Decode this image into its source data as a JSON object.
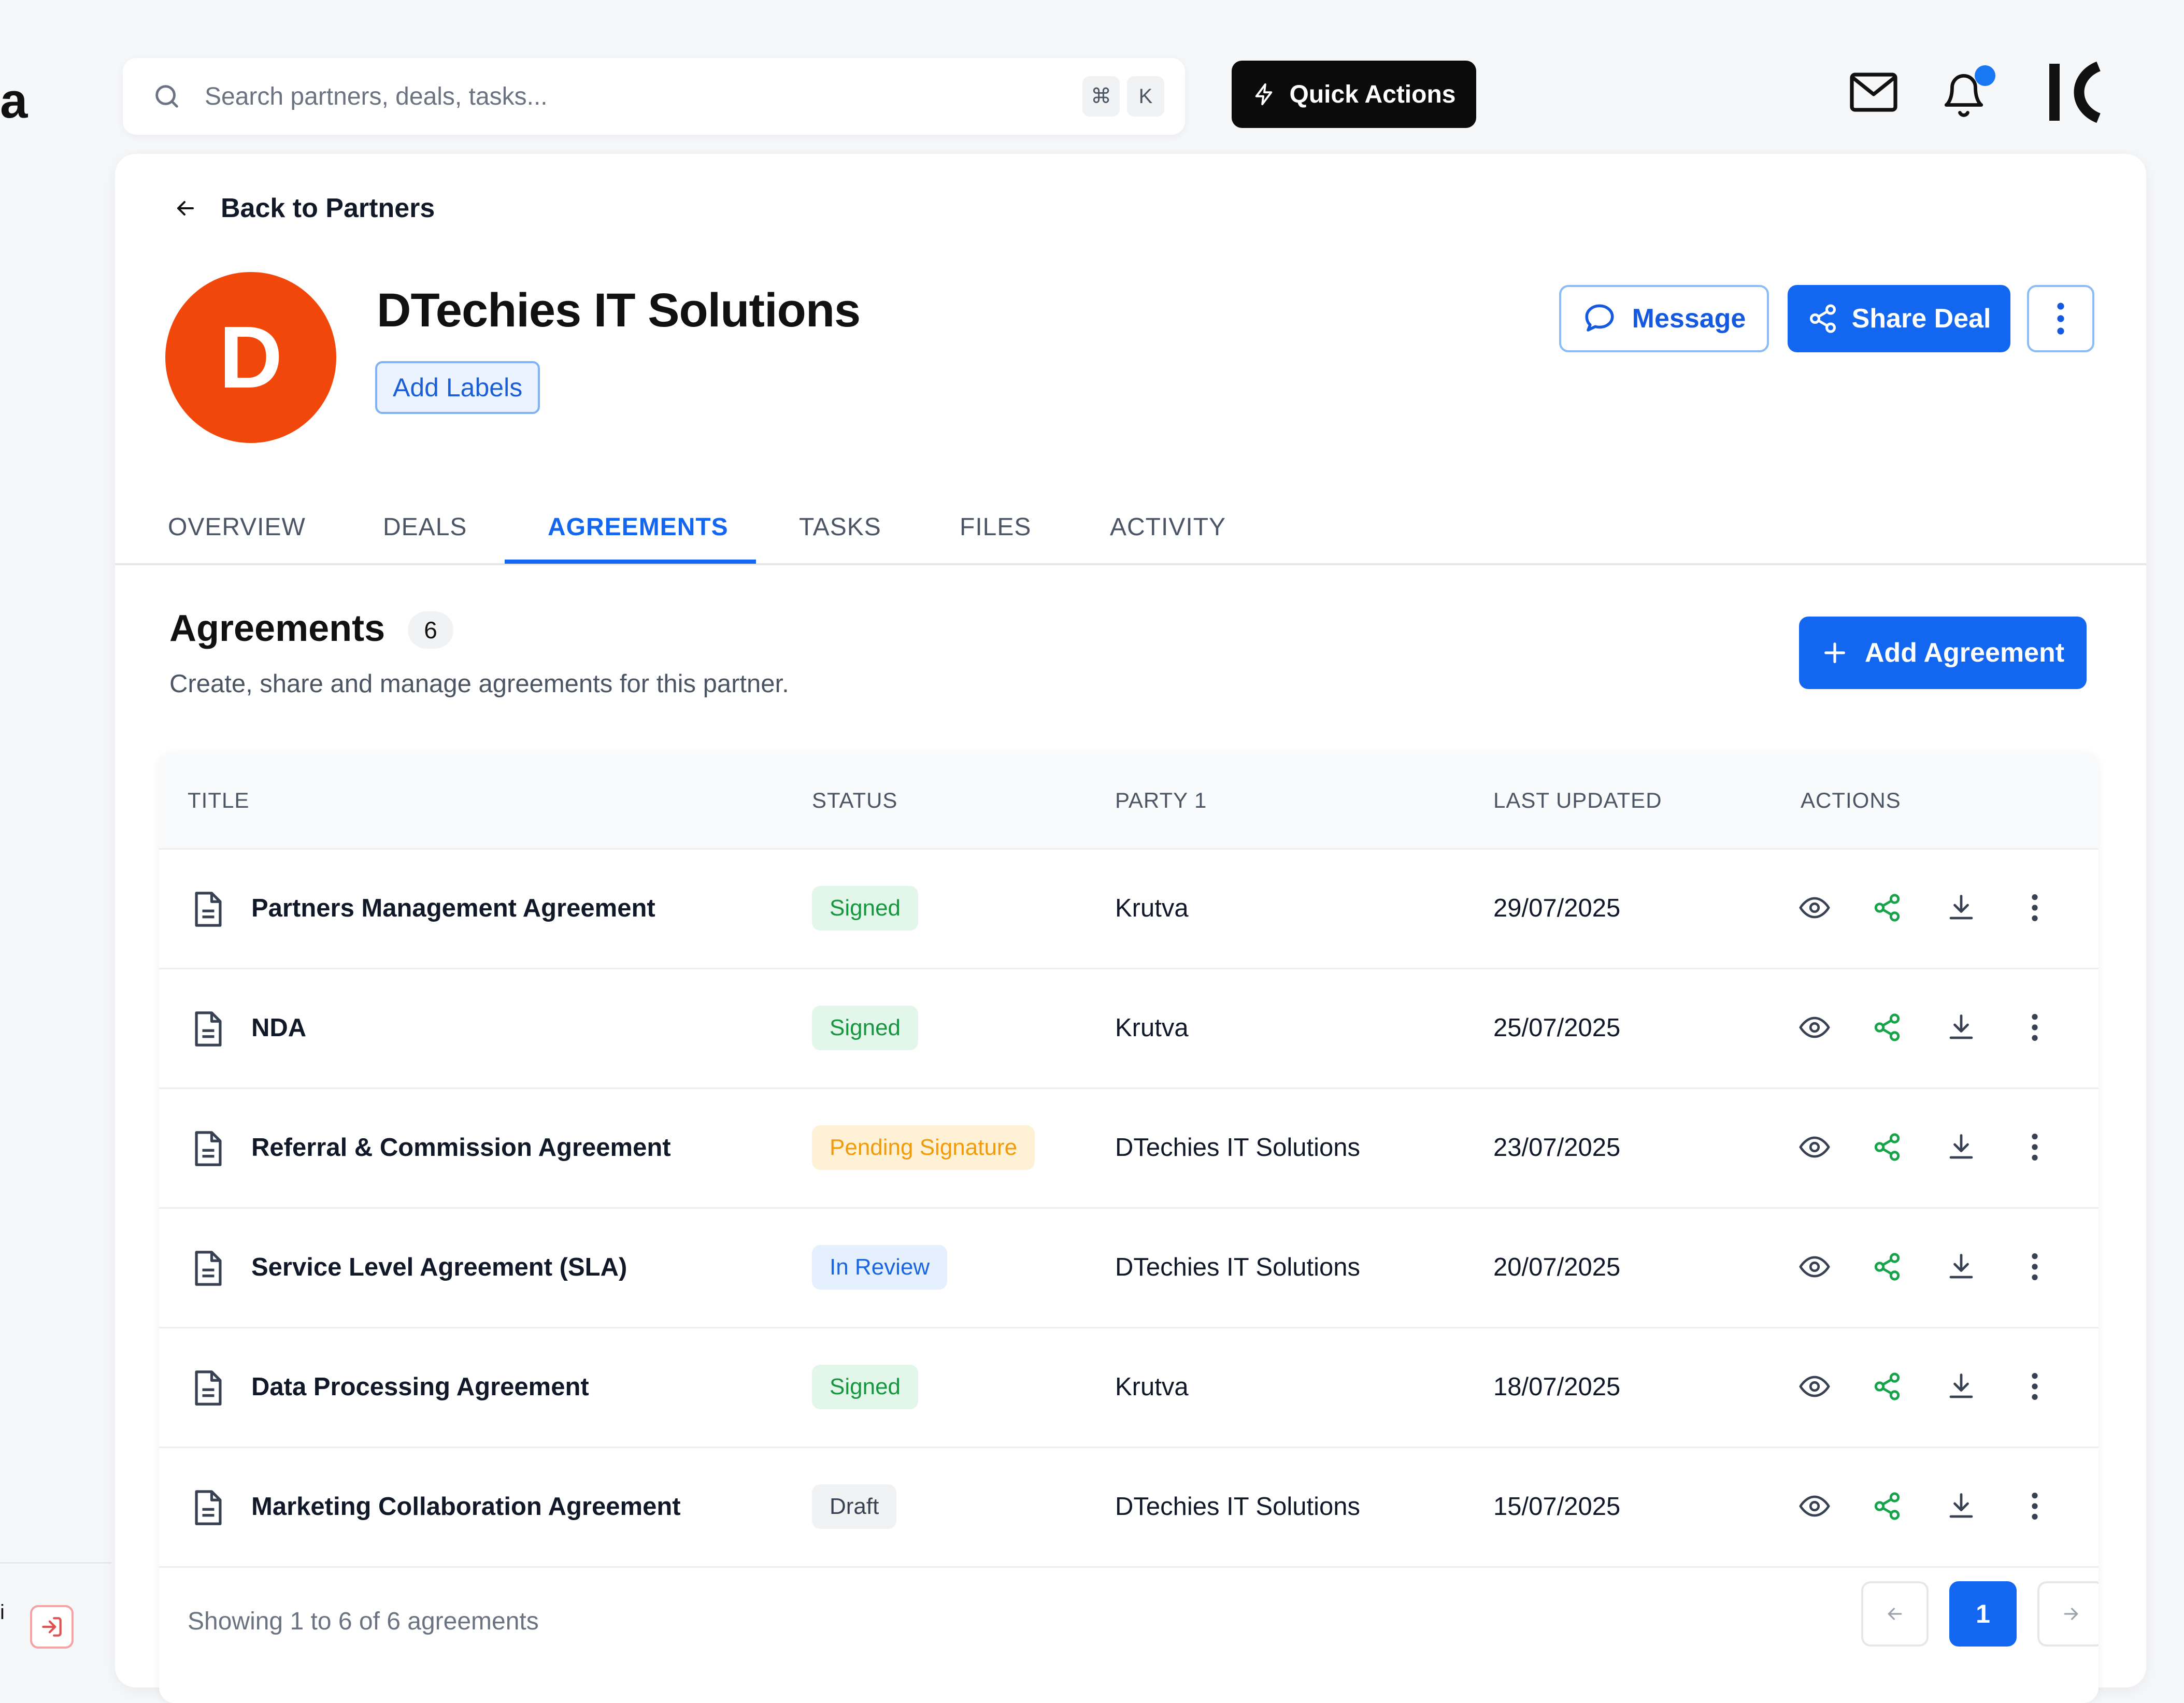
{
  "search": {
    "placeholder": "Search partners, deals, tasks...",
    "shortcut_key_1": "⌘",
    "shortcut_key_2": "K"
  },
  "header": {
    "quick_actions_label": "Quick Actions"
  },
  "sidebar": {
    "logo_fragment": "a",
    "user_fragment": "i"
  },
  "partner": {
    "back_label": "Back to Partners",
    "avatar_initial": "D",
    "name": "DTechies IT Solutions",
    "add_labels": "Add Labels",
    "message_label": "Message",
    "share_deal_label": "Share Deal"
  },
  "tabs": [
    {
      "label": "OVERVIEW"
    },
    {
      "label": "DEALS"
    },
    {
      "label": "AGREEMENTS"
    },
    {
      "label": "TASKS"
    },
    {
      "label": "FILES"
    },
    {
      "label": "ACTIVITY"
    }
  ],
  "agreements": {
    "title": "Agreements",
    "count": "6",
    "description": "Create, share and manage agreements for this partner.",
    "add_button": "Add Agreement",
    "columns": {
      "title": "TITLE",
      "status": "STATUS",
      "party": "PARTY 1",
      "updated": "LAST UPDATED",
      "actions": "ACTIONS"
    },
    "rows": [
      {
        "title": "Partners Management Agreement",
        "status": "Signed",
        "party": "Krutva",
        "updated": "29/07/2025"
      },
      {
        "title": "NDA",
        "status": "Signed",
        "party": "Krutva",
        "updated": "25/07/2025"
      },
      {
        "title": "Referral & Commission Agreement",
        "status": "Pending Signature",
        "party": "DTechies IT Solutions",
        "updated": "23/07/2025"
      },
      {
        "title": "Service Level Agreement (SLA)",
        "status": "In Review",
        "party": "DTechies IT Solutions",
        "updated": "20/07/2025"
      },
      {
        "title": "Data Processing Agreement",
        "status": "Signed",
        "party": "Krutva",
        "updated": "18/07/2025"
      },
      {
        "title": "Marketing Collaboration Agreement",
        "status": "Draft",
        "party": "DTechies IT Solutions",
        "updated": "15/07/2025"
      }
    ],
    "footer": "Showing 1 to 6 of 6 agreements",
    "current_page": "1"
  },
  "colors": {
    "accent": "#1366f0",
    "avatar": "#f2470a",
    "signed_bg": "#e3f6ea",
    "signed_fg": "#15963f",
    "pending_bg": "#fff1d6",
    "pending_fg": "#f29b0a",
    "review_bg": "#e4f0fe",
    "review_fg": "#1a66e0",
    "draft_bg": "#f1f2f4",
    "draft_fg": "#374151",
    "share_icon": "#16a34a"
  },
  "icons": {
    "search": "search-icon",
    "quick_actions": "lightning-icon",
    "mail": "mail-icon",
    "bell": "bell-icon",
    "back": "arrow-left-icon",
    "message": "chat-bubble-icon",
    "share": "share-icon",
    "more": "more-vertical-icon",
    "add": "plus-icon",
    "document": "document-icon",
    "view": "eye-icon",
    "download": "download-icon",
    "logout": "logout-icon",
    "prev": "chevron-left-icon",
    "next": "chevron-right-icon"
  }
}
